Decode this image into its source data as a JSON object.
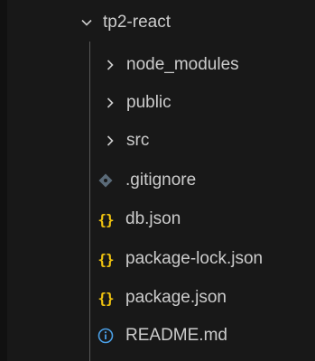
{
  "explorer": {
    "root": {
      "label": "tp2-react",
      "expanded": true
    },
    "folders": [
      {
        "label": "node_modules",
        "expanded": false
      },
      {
        "label": "public",
        "expanded": false
      },
      {
        "label": "src",
        "expanded": false
      }
    ],
    "files": [
      {
        "label": ".gitignore",
        "icon": "gitignore-icon"
      },
      {
        "label": "db.json",
        "icon": "json-braces-icon",
        "glyph": "{}"
      },
      {
        "label": "package-lock.json",
        "icon": "json-braces-icon",
        "glyph": "{}"
      },
      {
        "label": "package.json",
        "icon": "json-braces-icon",
        "glyph": "{}"
      },
      {
        "label": "README.md",
        "icon": "info-icon"
      }
    ]
  },
  "colors": {
    "background": "#181818",
    "text": "#cccccc",
    "json_icon": "#f1c40f",
    "info_icon": "#4a9fe6",
    "gitignore_icon": "#5a6a78",
    "indent_guide": "#585858"
  }
}
